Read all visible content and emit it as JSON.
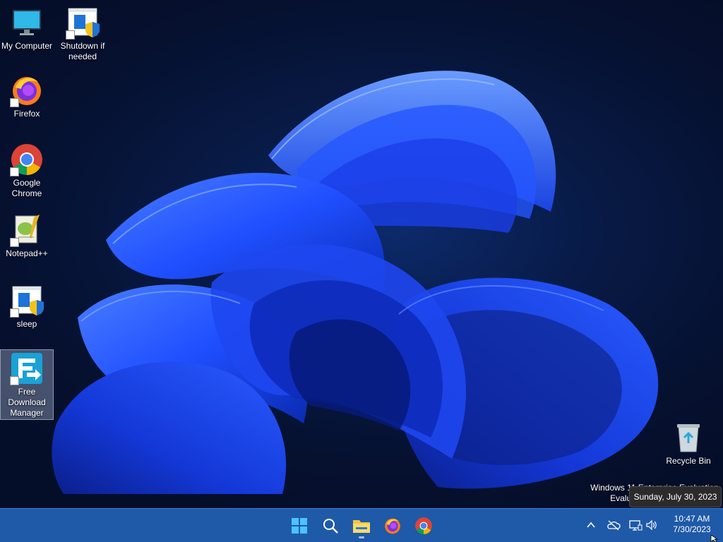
{
  "desktop": {
    "icons": [
      {
        "label": "My Computer",
        "icon": "monitor-icon"
      },
      {
        "label": "Shutdown if needed",
        "icon": "shield-shortcut-icon"
      },
      {
        "label": "Firefox",
        "icon": "firefox-icon"
      },
      {
        "label": "Google Chrome",
        "icon": "chrome-icon"
      },
      {
        "label": "Notepad++",
        "icon": "notepadpp-icon"
      },
      {
        "label": "sleep",
        "icon": "shield-shortcut-icon"
      },
      {
        "label": "Free Download Manager",
        "icon": "fdm-icon"
      },
      {
        "label": "Recycle Bin",
        "icon": "recycle-bin-icon"
      }
    ],
    "watermark": {
      "line1": "Windows 11 Enterprise Evaluation",
      "line2": "Evaluation copy. Build 25375"
    },
    "tooltip": "Sunday, July 30, 2023"
  },
  "taskbar": {
    "pinned": [
      "start-icon",
      "search-icon",
      "file-explorer-icon",
      "firefox-icon",
      "chrome-icon"
    ],
    "tray": [
      "chevron-up-icon",
      "onedrive-icon",
      "network-icon",
      "volume-icon"
    ],
    "clock": {
      "time": "10:47 AM",
      "date": "7/30/2023"
    }
  },
  "colors": {
    "taskbar": "#1e5aa8",
    "wallpaper_bg": "#061233",
    "bloom": "#1f4fff"
  }
}
